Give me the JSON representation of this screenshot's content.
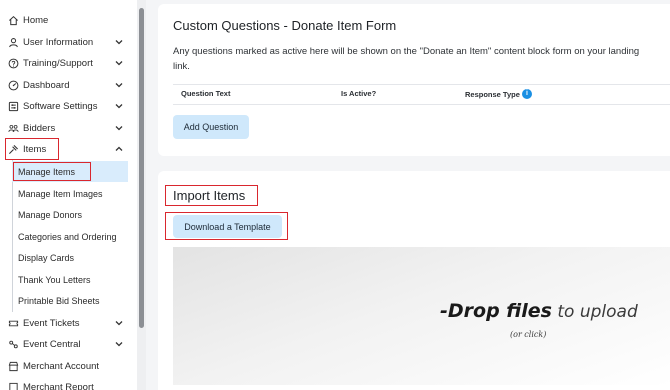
{
  "sidebar": {
    "items": [
      {
        "label": "Home",
        "icon": "home-icon"
      },
      {
        "label": "User Information",
        "icon": "user-icon"
      },
      {
        "label": "Training/Support",
        "icon": "question-icon"
      },
      {
        "label": "Dashboard",
        "icon": "dashboard-icon"
      },
      {
        "label": "Software Settings",
        "icon": "settings-icon"
      },
      {
        "label": "Bidders",
        "icon": "bidders-icon"
      },
      {
        "label": "Items",
        "icon": "gavel-icon"
      },
      {
        "label": "Event Tickets",
        "icon": "ticket-icon"
      },
      {
        "label": "Event Central",
        "icon": "event-central-icon"
      },
      {
        "label": "Merchant Account",
        "icon": "merchant-icon"
      },
      {
        "label": "Merchant Report",
        "icon": "report-icon"
      }
    ],
    "items_submenu": [
      "Manage Items",
      "Manage Item Images",
      "Manage Donors",
      "Categories and Ordering",
      "Display Cards",
      "Thank You Letters",
      "Printable Bid Sheets"
    ]
  },
  "custom_questions": {
    "title": "Custom Questions - Donate Item Form",
    "description_line1": "Any questions marked as active here will be shown on the \"Donate an Item\" content block form on your landing",
    "description_line2": "link.",
    "columns": [
      "Question Text",
      "Is Active?",
      "Response Type"
    ],
    "info_badge": "i",
    "add_button": "Add Question"
  },
  "import_items": {
    "title": "Import Items",
    "template_button": "Download a Template",
    "dropzone": {
      "prefix": "-",
      "bold": "Drop files",
      "light": " to upload",
      "sub": "(or click)"
    }
  },
  "colors": {
    "accent": "#1a8fe3",
    "button_bg": "#cfe8fb",
    "active_submenu": "#d9ecfc",
    "highlight": "#d9272e"
  }
}
